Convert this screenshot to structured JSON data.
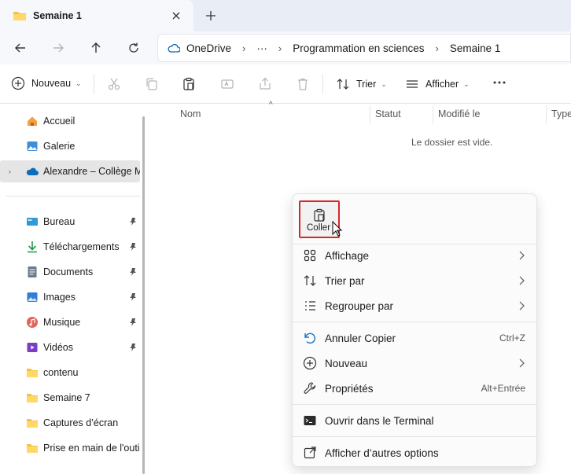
{
  "tab": {
    "title": "Semaine 1"
  },
  "address": {
    "crumbs": [
      "OneDrive",
      "···",
      "Programmation en sciences",
      "Semaine 1"
    ]
  },
  "toolbar": {
    "new_label": "Nouveau",
    "sort_label": "Trier",
    "view_label": "Afficher"
  },
  "sidebar": {
    "items": [
      {
        "label": "Accueil",
        "icon": "home-icon"
      },
      {
        "label": "Galerie",
        "icon": "gallery-icon"
      },
      {
        "label": "Alexandre – Collège Mo",
        "icon": "onedrive-cloud-icon"
      },
      {
        "label": "Bureau",
        "icon": "desktop-icon"
      },
      {
        "label": "Téléchargements",
        "icon": "download-icon"
      },
      {
        "label": "Documents",
        "icon": "documents-icon"
      },
      {
        "label": "Images",
        "icon": "pictures-icon"
      },
      {
        "label": "Musique",
        "icon": "music-icon"
      },
      {
        "label": "Vidéos",
        "icon": "videos-icon"
      },
      {
        "label": "contenu",
        "icon": "folder-icon"
      },
      {
        "label": "Semaine 7",
        "icon": "folder-icon"
      },
      {
        "label": "Captures d’écran",
        "icon": "folder-icon"
      },
      {
        "label": "Prise en main de l'outil",
        "icon": "folder-icon"
      }
    ]
  },
  "columns": {
    "name": "Nom",
    "status": "Statut",
    "modified": "Modifié le",
    "type": "Type"
  },
  "empty_message": "Le dossier est vide.",
  "context_menu": {
    "paste_label": "Coller",
    "items": {
      "view": "Affichage",
      "sort_by": "Trier par",
      "group_by": "Regrouper par",
      "undo": "Annuler Copier",
      "undo_shortcut": "Ctrl+Z",
      "new": "Nouveau",
      "properties": "Propriétés",
      "properties_shortcut": "Alt+Entrée",
      "terminal": "Ouvrir dans le Terminal",
      "more_options": "Afficher d’autres options"
    }
  },
  "colors": {
    "accent": "#0067c0",
    "highlight_box": "#d9262c",
    "folder": "#f5c242"
  }
}
